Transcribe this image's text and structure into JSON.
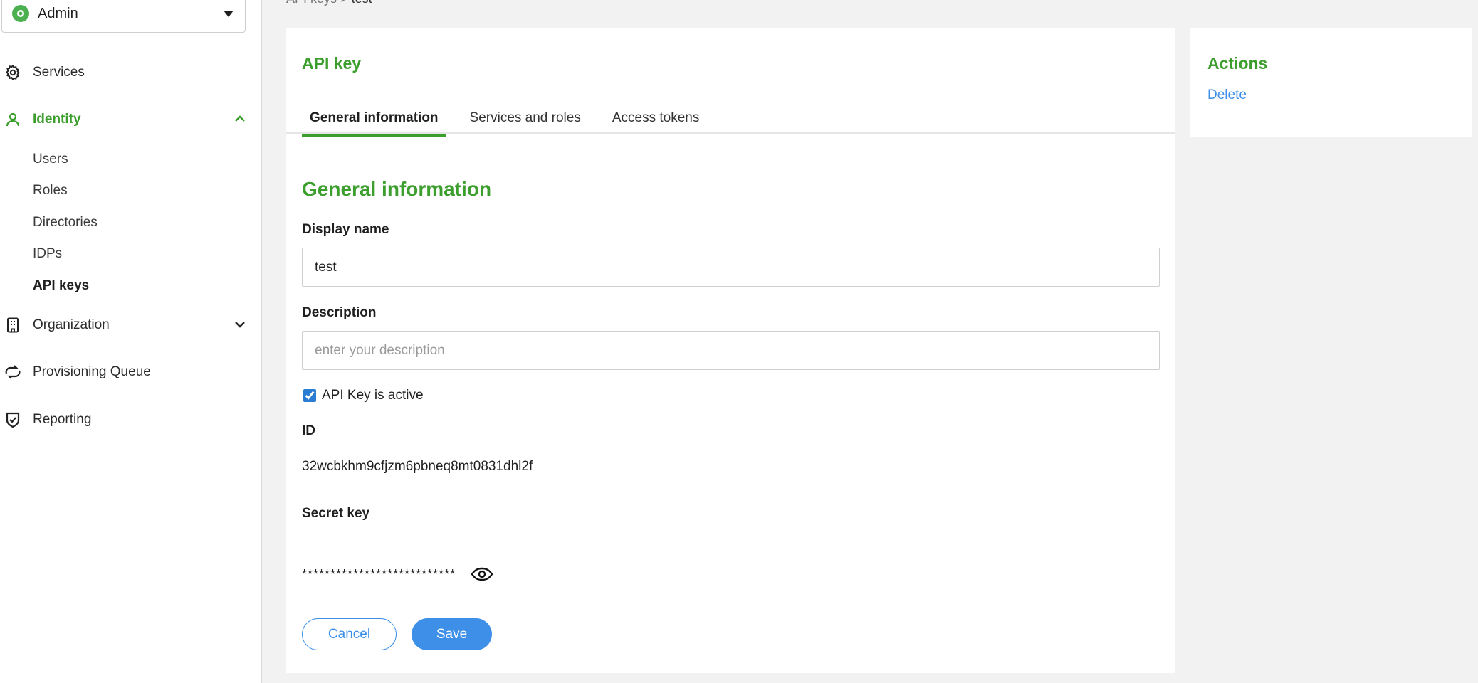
{
  "sidebar": {
    "org_select": {
      "label": "Admin"
    },
    "items": {
      "services": {
        "label": "Services",
        "icon": "gear-icon"
      },
      "identity": {
        "label": "Identity",
        "icon": "user-icon"
      },
      "organization": {
        "label": "Organization",
        "icon": "building-icon"
      },
      "provisioning": {
        "label": "Provisioning Queue",
        "icon": "sync-icon"
      },
      "reporting": {
        "label": "Reporting",
        "icon": "shield-check-icon"
      }
    },
    "identity_sub": [
      "Users",
      "Roles",
      "Directories",
      "IDPs",
      "API keys"
    ]
  },
  "breadcrumb": {
    "parent": "API keys",
    "separator": ">",
    "current": "test"
  },
  "main": {
    "title": "API key",
    "tabs": [
      "General information",
      "Services and roles",
      "Access tokens"
    ],
    "active_tab": "General information",
    "section_title": "General information",
    "display_name": {
      "label": "Display name",
      "value": "test"
    },
    "description": {
      "label": "Description",
      "placeholder": "enter your description",
      "value": ""
    },
    "active_checkbox": {
      "label": "API Key is active",
      "checked": true
    },
    "id": {
      "label": "ID",
      "value": "32wcbkhm9cfjzm6pbneq8mt0831dhl2f"
    },
    "secret_key": {
      "label": "Secret key",
      "value": "***************************"
    },
    "buttons": {
      "cancel": "Cancel",
      "save": "Save"
    }
  },
  "actions": {
    "title": "Actions",
    "delete": "Delete"
  },
  "colors": {
    "accent_green": "#3c9e2d",
    "link_blue": "#3d8fe8"
  }
}
